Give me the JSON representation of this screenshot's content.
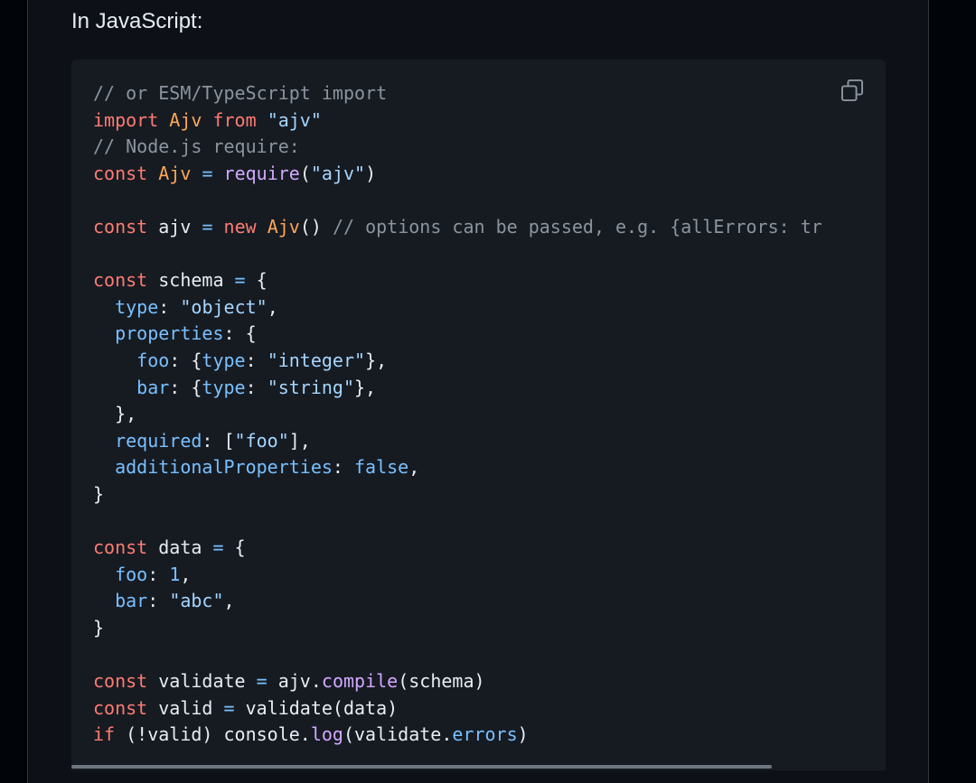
{
  "section": {
    "heading": "In JavaScript:"
  },
  "code_block": {
    "language": "javascript",
    "copy_icon": "copy-icon",
    "colors": {
      "background": "#161b22",
      "plain": "#e6edf3",
      "comment": "#8b949e",
      "keyword": "#ff7b72",
      "class": "#ffa657",
      "string": "#a5d6ff",
      "function": "#d2a8ff",
      "constant": "#79c0ff"
    },
    "lines": [
      [
        {
          "t": "comment",
          "v": "// or ESM/TypeScript import"
        }
      ],
      [
        {
          "t": "keyword",
          "v": "import"
        },
        {
          "t": "plain",
          "v": " "
        },
        {
          "t": "class",
          "v": "Ajv"
        },
        {
          "t": "plain",
          "v": " "
        },
        {
          "t": "keyword",
          "v": "from"
        },
        {
          "t": "plain",
          "v": " "
        },
        {
          "t": "string",
          "v": "\"ajv\""
        }
      ],
      [
        {
          "t": "comment",
          "v": "// Node.js require:"
        }
      ],
      [
        {
          "t": "keyword",
          "v": "const"
        },
        {
          "t": "plain",
          "v": " "
        },
        {
          "t": "class",
          "v": "Ajv"
        },
        {
          "t": "plain",
          "v": " "
        },
        {
          "t": "constant",
          "v": "="
        },
        {
          "t": "plain",
          "v": " "
        },
        {
          "t": "func",
          "v": "require"
        },
        {
          "t": "plain",
          "v": "("
        },
        {
          "t": "string",
          "v": "\"ajv\""
        },
        {
          "t": "plain",
          "v": ")"
        }
      ],
      [],
      [
        {
          "t": "keyword",
          "v": "const"
        },
        {
          "t": "plain",
          "v": " ajv "
        },
        {
          "t": "constant",
          "v": "="
        },
        {
          "t": "plain",
          "v": " "
        },
        {
          "t": "keyword",
          "v": "new"
        },
        {
          "t": "plain",
          "v": " "
        },
        {
          "t": "class",
          "v": "Ajv"
        },
        {
          "t": "plain",
          "v": "() "
        },
        {
          "t": "comment",
          "v": "// options can be passed, e.g. {allErrors: tr"
        }
      ],
      [],
      [
        {
          "t": "keyword",
          "v": "const"
        },
        {
          "t": "plain",
          "v": " schema "
        },
        {
          "t": "constant",
          "v": "="
        },
        {
          "t": "plain",
          "v": " {"
        }
      ],
      [
        {
          "t": "plain",
          "v": "  "
        },
        {
          "t": "constant",
          "v": "type"
        },
        {
          "t": "plain",
          "v": ": "
        },
        {
          "t": "string",
          "v": "\"object\""
        },
        {
          "t": "plain",
          "v": ","
        }
      ],
      [
        {
          "t": "plain",
          "v": "  "
        },
        {
          "t": "constant",
          "v": "properties"
        },
        {
          "t": "plain",
          "v": ": {"
        }
      ],
      [
        {
          "t": "plain",
          "v": "    "
        },
        {
          "t": "constant",
          "v": "foo"
        },
        {
          "t": "plain",
          "v": ": {"
        },
        {
          "t": "constant",
          "v": "type"
        },
        {
          "t": "plain",
          "v": ": "
        },
        {
          "t": "string",
          "v": "\"integer\""
        },
        {
          "t": "plain",
          "v": "},"
        }
      ],
      [
        {
          "t": "plain",
          "v": "    "
        },
        {
          "t": "constant",
          "v": "bar"
        },
        {
          "t": "plain",
          "v": ": {"
        },
        {
          "t": "constant",
          "v": "type"
        },
        {
          "t": "plain",
          "v": ": "
        },
        {
          "t": "string",
          "v": "\"string\""
        },
        {
          "t": "plain",
          "v": "},"
        }
      ],
      [
        {
          "t": "plain",
          "v": "  },"
        }
      ],
      [
        {
          "t": "plain",
          "v": "  "
        },
        {
          "t": "constant",
          "v": "required"
        },
        {
          "t": "plain",
          "v": ": ["
        },
        {
          "t": "string",
          "v": "\"foo\""
        },
        {
          "t": "plain",
          "v": "],"
        }
      ],
      [
        {
          "t": "plain",
          "v": "  "
        },
        {
          "t": "constant",
          "v": "additionalProperties"
        },
        {
          "t": "plain",
          "v": ": "
        },
        {
          "t": "constant",
          "v": "false"
        },
        {
          "t": "plain",
          "v": ","
        }
      ],
      [
        {
          "t": "plain",
          "v": "}"
        }
      ],
      [],
      [
        {
          "t": "keyword",
          "v": "const"
        },
        {
          "t": "plain",
          "v": " data "
        },
        {
          "t": "constant",
          "v": "="
        },
        {
          "t": "plain",
          "v": " {"
        }
      ],
      [
        {
          "t": "plain",
          "v": "  "
        },
        {
          "t": "constant",
          "v": "foo"
        },
        {
          "t": "plain",
          "v": ": "
        },
        {
          "t": "constant",
          "v": "1"
        },
        {
          "t": "plain",
          "v": ","
        }
      ],
      [
        {
          "t": "plain",
          "v": "  "
        },
        {
          "t": "constant",
          "v": "bar"
        },
        {
          "t": "plain",
          "v": ": "
        },
        {
          "t": "string",
          "v": "\"abc\""
        },
        {
          "t": "plain",
          "v": ","
        }
      ],
      [
        {
          "t": "plain",
          "v": "}"
        }
      ],
      [],
      [
        {
          "t": "keyword",
          "v": "const"
        },
        {
          "t": "plain",
          "v": " validate "
        },
        {
          "t": "constant",
          "v": "="
        },
        {
          "t": "plain",
          "v": " ajv."
        },
        {
          "t": "func",
          "v": "compile"
        },
        {
          "t": "plain",
          "v": "(schema)"
        }
      ],
      [
        {
          "t": "keyword",
          "v": "const"
        },
        {
          "t": "plain",
          "v": " valid "
        },
        {
          "t": "constant",
          "v": "="
        },
        {
          "t": "plain",
          "v": " validate(data)"
        }
      ],
      [
        {
          "t": "keyword",
          "v": "if"
        },
        {
          "t": "plain",
          "v": " (!valid) console."
        },
        {
          "t": "func",
          "v": "log"
        },
        {
          "t": "plain",
          "v": "(validate."
        },
        {
          "t": "constant",
          "v": "errors"
        },
        {
          "t": "plain",
          "v": ")"
        }
      ]
    ],
    "scrollbar": {
      "horizontal_position": 0,
      "visible_fraction": 0.86
    }
  }
}
